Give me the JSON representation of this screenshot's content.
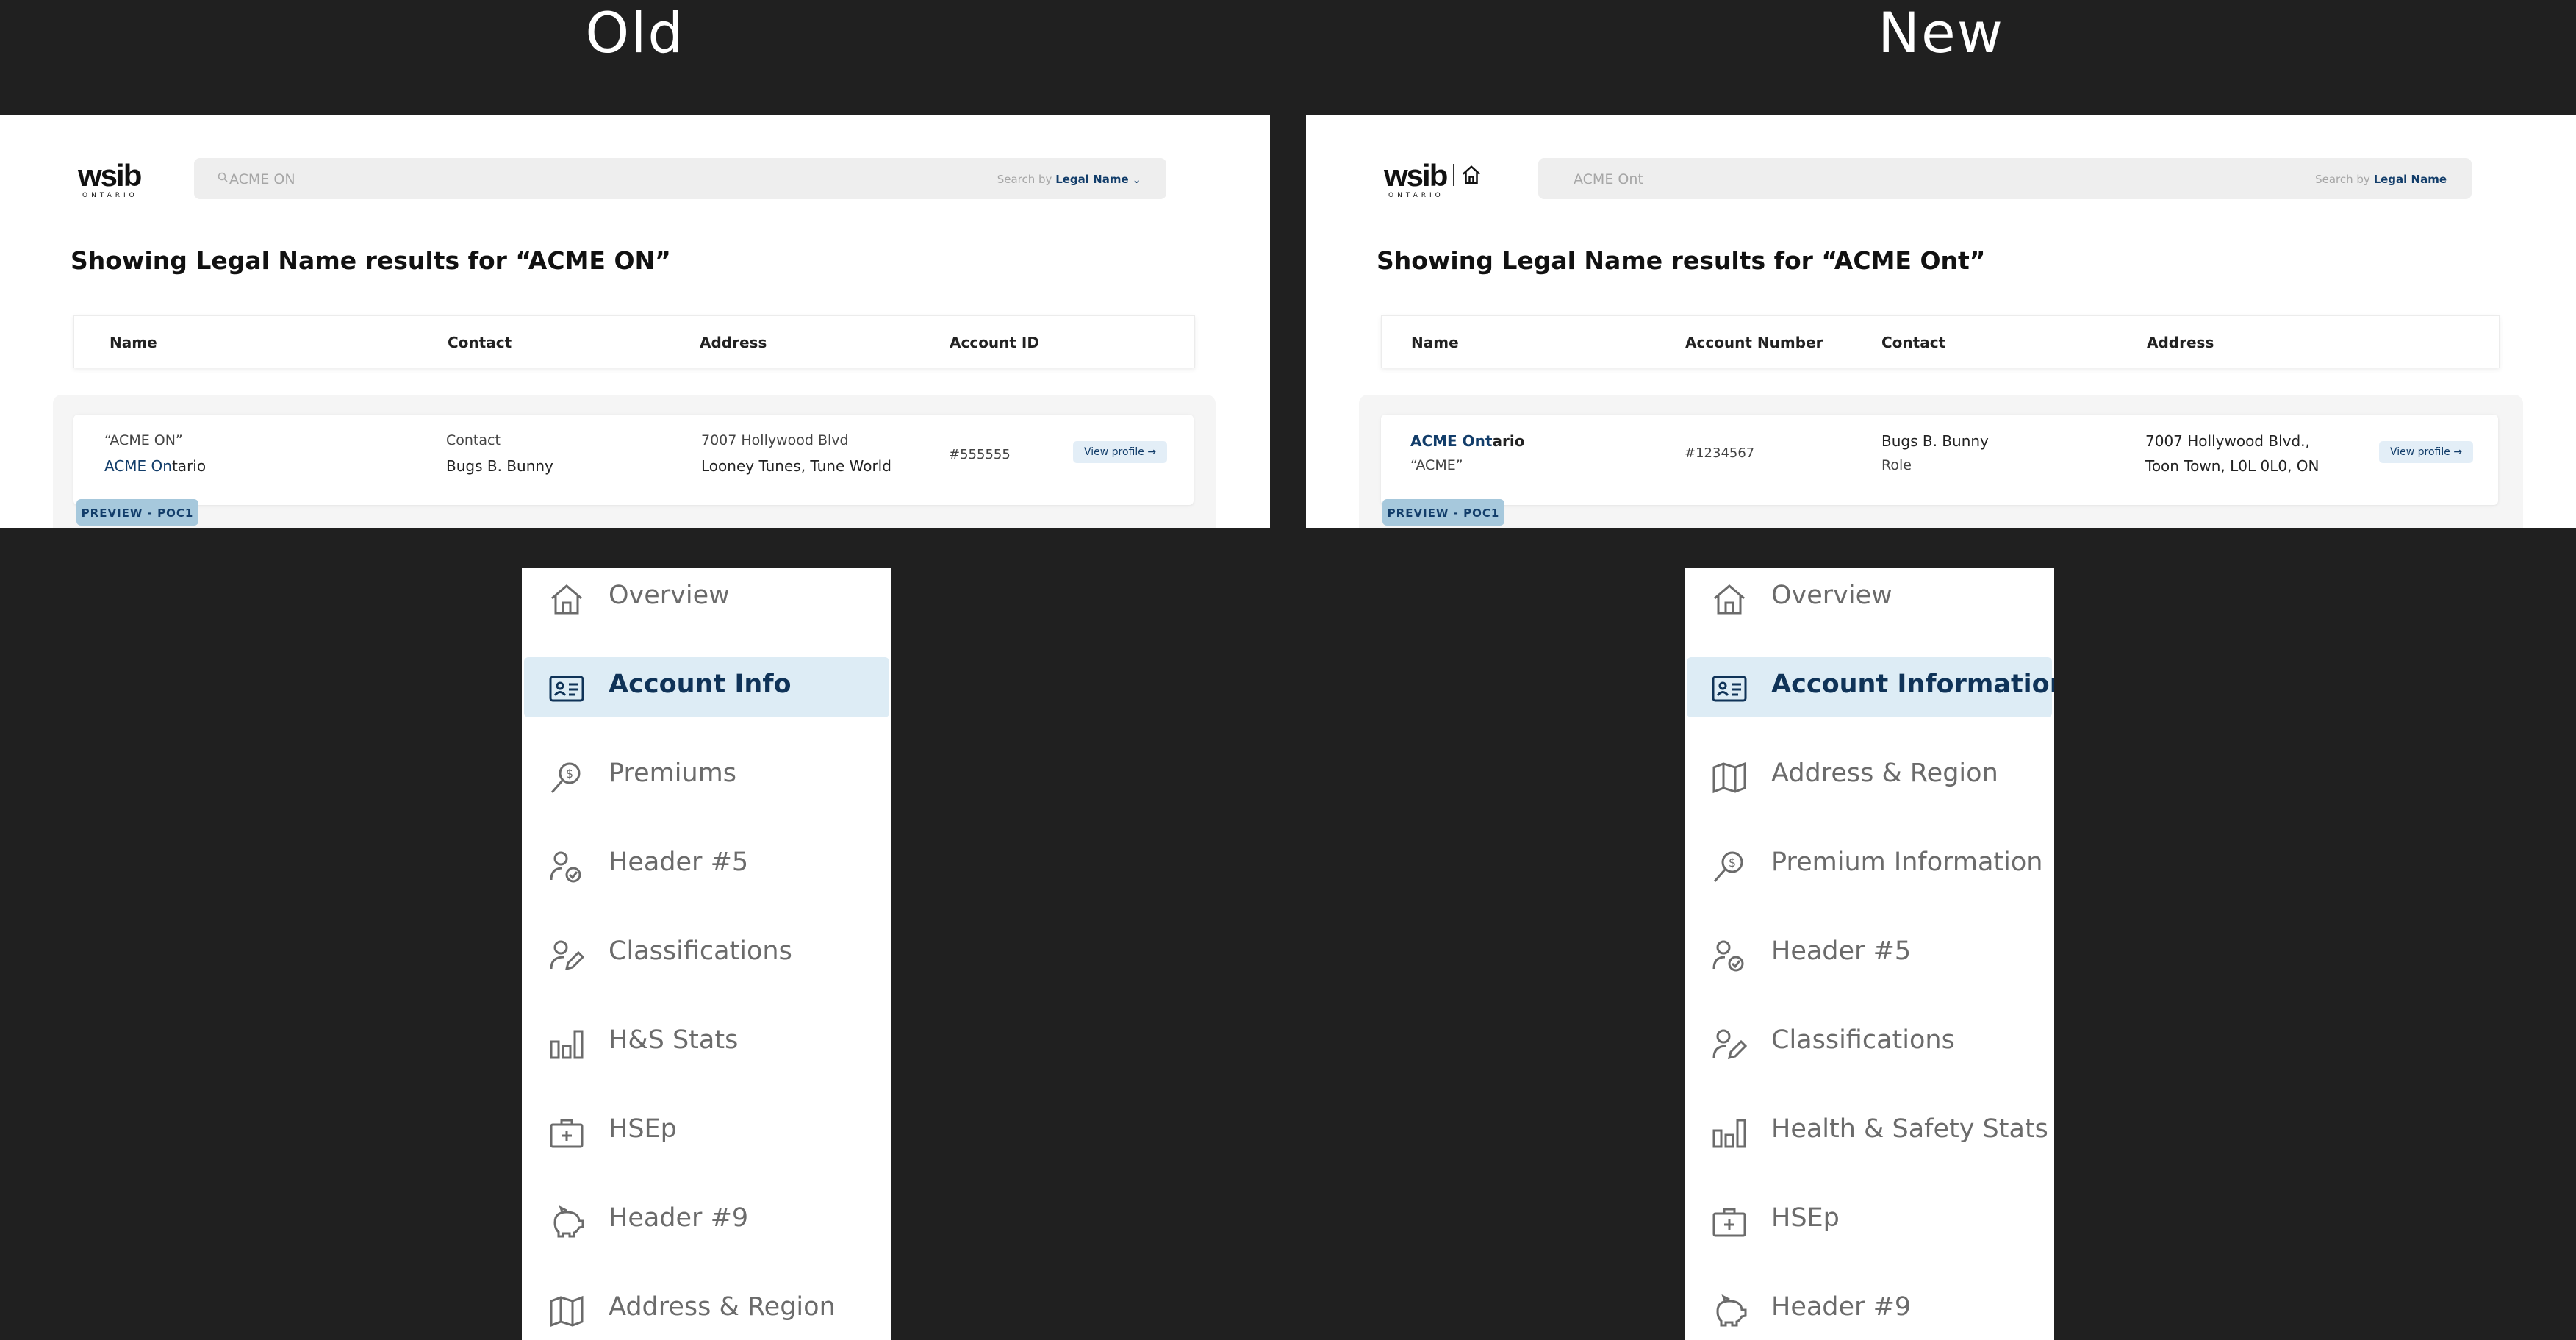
{
  "headings": {
    "old": "Old",
    "new": "New"
  },
  "old": {
    "logo": {
      "brand": "wsib",
      "sub": "ONTARIO"
    },
    "search": {
      "query": "ACME ON",
      "by_prefix": "Search by",
      "by_field": "Legal Name"
    },
    "title": "Showing Legal Name results for “ACME ON”",
    "columns": [
      "Name",
      "Contact",
      "Address",
      "Account ID"
    ],
    "row": {
      "name_quoted": "“ACME ON”",
      "name_highlight": "ACME On",
      "name_rest": "tario",
      "contact_label": "Contact",
      "contact_name": "Bugs B. Bunny",
      "address_line1": "7007 Hollywood Blvd",
      "address_line2": "Looney Tunes, Tune World",
      "account_id": "#555555",
      "view_label": "View profile"
    },
    "badge": "PREVIEW - POC1",
    "nav": [
      {
        "label": "Overview",
        "icon": "home-icon"
      },
      {
        "label": "Account Info",
        "icon": "id-card-icon",
        "active": true
      },
      {
        "label": "Premiums",
        "icon": "dollar-search-icon"
      },
      {
        "label": "Header #5",
        "icon": "user-check-icon"
      },
      {
        "label": "Classifications",
        "icon": "user-edit-icon"
      },
      {
        "label": "H&S Stats",
        "icon": "bar-chart-icon"
      },
      {
        "label": "HSEp",
        "icon": "first-aid-icon"
      },
      {
        "label": "Header #9",
        "icon": "piggy-bank-icon"
      },
      {
        "label": "Address & Region",
        "icon": "map-icon"
      }
    ]
  },
  "new": {
    "logo": {
      "brand": "wsib",
      "sub": "ONTARIO"
    },
    "search": {
      "query": "ACME Ont",
      "by_prefix": "Search by",
      "by_field": "Legal Name"
    },
    "title": "Showing Legal Name results for “ACME Ont”",
    "columns": [
      "Name",
      "Account Number",
      "Contact",
      "Address"
    ],
    "row": {
      "name_highlight": "ACME Ont",
      "name_rest": "ario",
      "name_quoted": "“ACME”",
      "account_number": "#1234567",
      "contact_name": "Bugs B. Bunny",
      "contact_role": "Role",
      "address_line1": "7007 Hollywood Blvd.,",
      "address_line2": "Toon Town, L0L 0L0, ON",
      "view_label": "View profile"
    },
    "badge": "PREVIEW - POC1",
    "nav": [
      {
        "label": "Overview",
        "icon": "home-icon"
      },
      {
        "label": "Account Information",
        "icon": "id-card-icon",
        "active": true
      },
      {
        "label": "Address & Region",
        "icon": "map-icon"
      },
      {
        "label": "Premium Information",
        "icon": "dollar-search-icon"
      },
      {
        "label": "Header #5",
        "icon": "user-check-icon"
      },
      {
        "label": "Classifications",
        "icon": "user-edit-icon"
      },
      {
        "label": "Health & Safety Stats",
        "icon": "bar-chart-icon"
      },
      {
        "label": "HSEp",
        "icon": "first-aid-icon"
      },
      {
        "label": "Header #9",
        "icon": "piggy-bank-icon"
      }
    ]
  },
  "colors": {
    "accent": "#123d6a",
    "active_bg": "#ddecf5",
    "badge_bg": "#a6c8dc",
    "background": "#202020"
  }
}
